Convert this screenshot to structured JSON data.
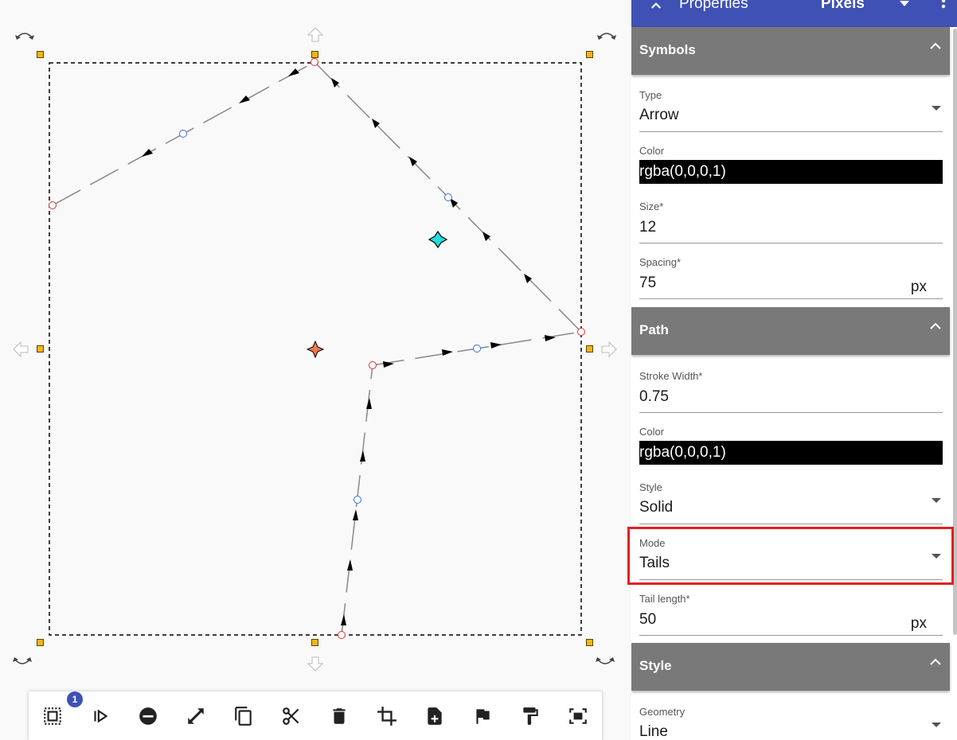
{
  "panel": {
    "title": "Properties",
    "units": "Pixels"
  },
  "toolbar": {
    "badge_count": "1",
    "buttons": [
      "select-all",
      "play",
      "remove",
      "resize",
      "copy",
      "cut",
      "delete",
      "crop",
      "add-page",
      "flag",
      "format-paint",
      "fit-screen"
    ]
  },
  "sections": {
    "symbols": {
      "title": "Symbols",
      "type_label": "Type",
      "type_value": "Arrow",
      "color_label": "Color",
      "color_value": "rgba(0,0,0,1)",
      "size_label": "Size*",
      "size_value": "12",
      "spacing_label": "Spacing*",
      "spacing_value": "75",
      "spacing_unit": "px"
    },
    "path": {
      "title": "Path",
      "stroke_width_label": "Stroke Width*",
      "stroke_width_value": "0.75",
      "color_label": "Color",
      "color_value": "rgba(0,0,0,1)",
      "style_label": "Style",
      "style_value": "Solid",
      "mode_label": "Mode",
      "mode_value": "Tails",
      "tail_length_label": "Tail length*",
      "tail_length_value": "50",
      "tail_length_unit": "px"
    },
    "style": {
      "title": "Style",
      "geometry_label": "Geometry",
      "geometry_value": "Line"
    }
  },
  "colors": {
    "header": "#3f51b5",
    "section": "#797979",
    "handle": "#f2b418",
    "highlight": "#e02020",
    "center_marker": "#f07850",
    "pivot_marker": "#22dddd"
  }
}
